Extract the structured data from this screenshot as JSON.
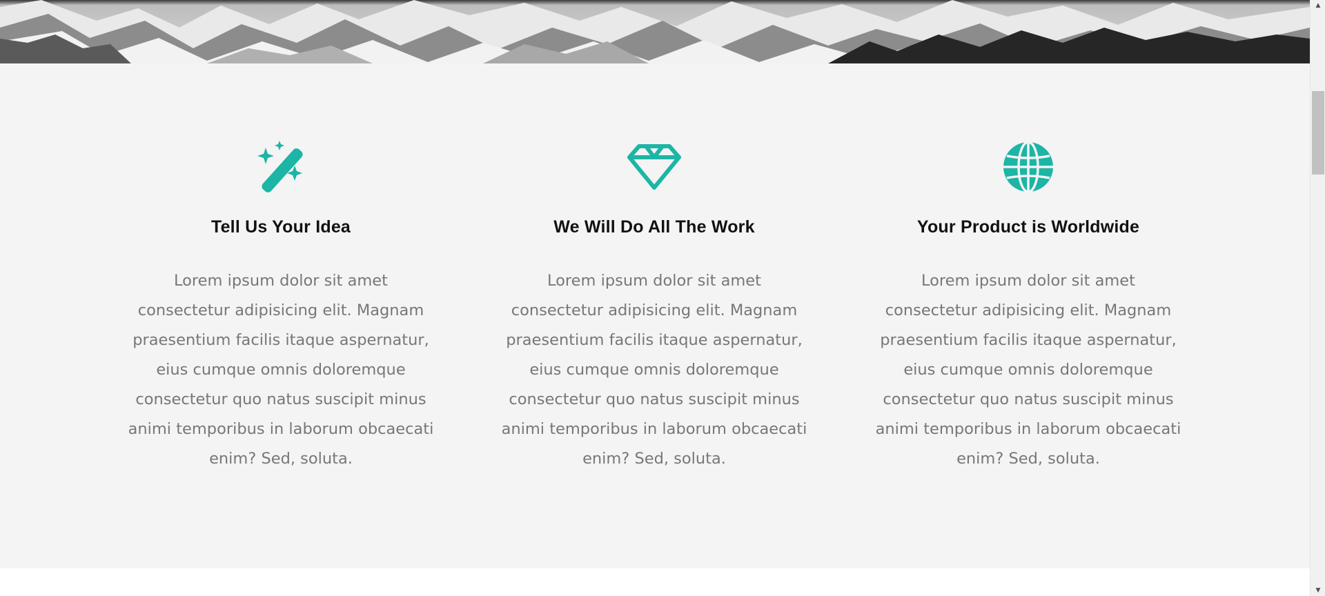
{
  "hero": {
    "image_alt": "snowy-mountains-banner"
  },
  "colors": {
    "accent": "#1db5a5",
    "section_background": "#f4f4f4",
    "title": "#111111",
    "body_text": "#777777"
  },
  "features": [
    {
      "icon": "magic-wand-icon",
      "title": "Tell Us Your Idea",
      "text": "Lorem ipsum dolor sit amet consectetur adipisicing elit. Magnam praesentium facilis itaque aspernatur, eius cumque omnis doloremque consectetur quo natus suscipit minus animi temporibus in laborum obcaecati enim? Sed, soluta."
    },
    {
      "icon": "gem-icon",
      "title": "We Will Do All The Work",
      "text": "Lorem ipsum dolor sit amet consectetur adipisicing elit. Magnam praesentium facilis itaque aspernatur, eius cumque omnis doloremque consectetur quo natus suscipit minus animi temporibus in laborum obcaecati enim? Sed, soluta."
    },
    {
      "icon": "globe-icon",
      "title": "Your Product is Worldwide",
      "text": "Lorem ipsum dolor sit amet consectetur adipisicing elit. Magnam praesentium facilis itaque aspernatur, eius cumque omnis doloremque consectetur quo natus suscipit minus animi temporibus in laborum obcaecati enim? Sed, soluta."
    }
  ],
  "scrollbar": {
    "up_arrow": "▲",
    "down_arrow": "▼"
  }
}
